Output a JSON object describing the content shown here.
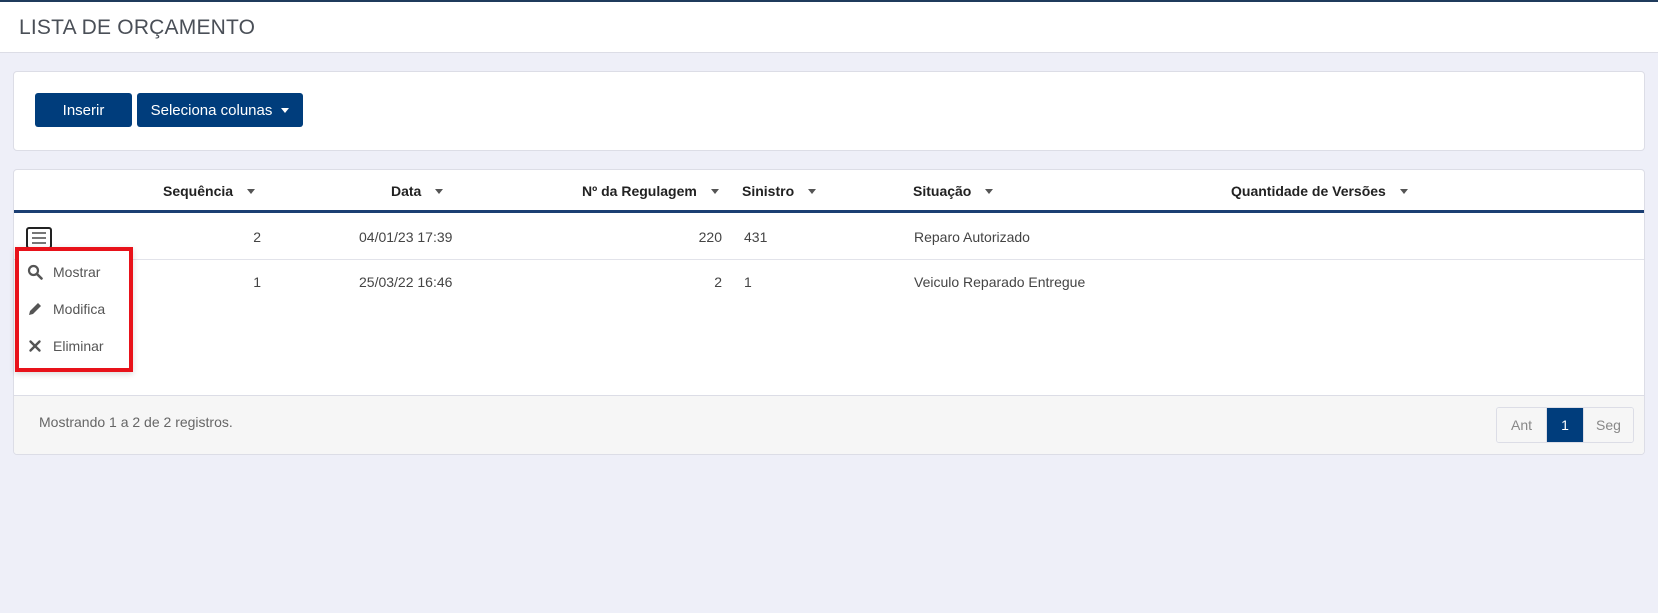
{
  "header": {
    "title": "LISTA DE ORÇAMENTO"
  },
  "toolbar": {
    "insert_label": "Inserir",
    "columns_label": "Seleciona colunas"
  },
  "table": {
    "columns": [
      "Sequência",
      "Data",
      "Nº da Regulagem",
      "Sinistro",
      "Situação",
      "Quantidade de Versões"
    ],
    "rows": [
      {
        "sequencia": "2",
        "data": "04/01/23 17:39",
        "regulagem": "220",
        "sinistro": "431",
        "situacao": "Reparo Autorizado"
      },
      {
        "sequencia": "1",
        "data": "25/03/22 16:46",
        "regulagem": "2",
        "sinistro": "1",
        "situacao": "Veiculo Reparado Entregue"
      }
    ]
  },
  "row_menu": {
    "items": [
      {
        "label": "Mostrar",
        "icon": "search-icon"
      },
      {
        "label": "Modifica",
        "icon": "pencil-icon"
      },
      {
        "label": "Eliminar",
        "icon": "close-icon"
      }
    ]
  },
  "footer": {
    "info": "Mostrando 1 a 2 de 2 registros.",
    "prev_label": "Ant",
    "current_page": "1",
    "next_label": "Seg"
  },
  "colors": {
    "primary": "#003d7c",
    "highlight_border": "#e8121a",
    "background": "#eeeff8"
  }
}
